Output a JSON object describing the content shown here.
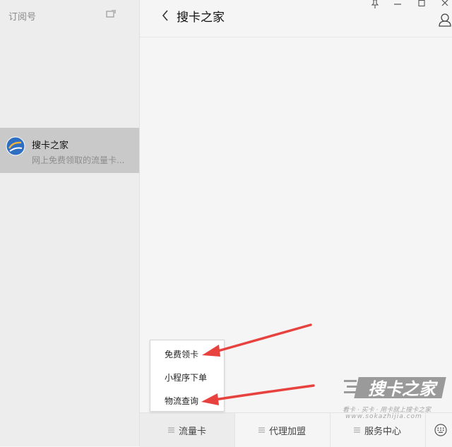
{
  "sidebar": {
    "title": "订阅号",
    "new_window_icon": "new-window-icon",
    "conversations": [
      {
        "name": "搜卡之家",
        "preview": "网上免费领取的流量卡...",
        "selected": true
      }
    ]
  },
  "chat": {
    "title": "搜卡之家",
    "back_icon": "chevron-left-icon",
    "profile_icon": "profile-icon"
  },
  "window_controls": [
    "pin-icon",
    "minimize-icon",
    "maximize-icon",
    "close-icon"
  ],
  "menu": {
    "tabs": [
      {
        "label": "流量卡",
        "active": true
      },
      {
        "label": "代理加盟",
        "active": false
      },
      {
        "label": "服务中心",
        "active": false
      }
    ],
    "keyboard_icon": "keyboard-icon"
  },
  "popup": {
    "items": [
      "免费领卡",
      "小程序下单",
      "物流查询"
    ]
  },
  "annotation": {
    "arrow_color": "#e8423f"
  },
  "watermark": {
    "logo_text": "搜卡之家",
    "tagline": "看卡 · 买卡 · 用卡就上搜卡之家",
    "url": "www.sokazhijia.com"
  },
  "colors": {
    "accent_arrow": "#e8423f",
    "selected_item_bg": "#c9c9c9",
    "sidebar_bg": "#eeeded",
    "main_bg": "#f5f5f5"
  }
}
